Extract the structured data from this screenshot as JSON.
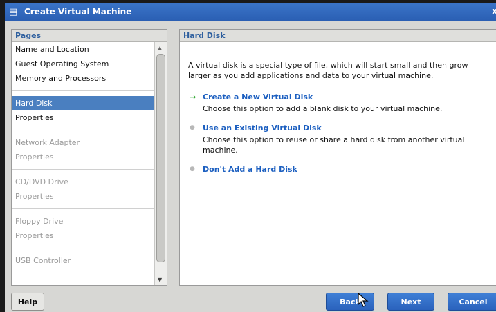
{
  "window": {
    "title": "Create Virtual Machine",
    "close_glyph": "x"
  },
  "pages_panel": {
    "header": "Pages",
    "groups": [
      {
        "items": [
          {
            "label": "Name and Location",
            "state": "normal"
          },
          {
            "label": "Guest Operating System",
            "state": "normal"
          },
          {
            "label": "Memory and Processors",
            "state": "normal"
          }
        ]
      },
      {
        "items": [
          {
            "label": "Hard Disk",
            "state": "selected"
          },
          {
            "label": "Properties",
            "state": "normal"
          }
        ]
      },
      {
        "items": [
          {
            "label": "Network Adapter",
            "state": "disabled"
          },
          {
            "label": "Properties",
            "state": "disabled"
          }
        ]
      },
      {
        "items": [
          {
            "label": "CD/DVD Drive",
            "state": "disabled"
          },
          {
            "label": "Properties",
            "state": "disabled"
          }
        ]
      },
      {
        "items": [
          {
            "label": "Floppy Drive",
            "state": "disabled"
          },
          {
            "label": "Properties",
            "state": "disabled"
          }
        ]
      },
      {
        "items": [
          {
            "label": "USB Controller",
            "state": "disabled"
          }
        ]
      }
    ]
  },
  "content_panel": {
    "header": "Hard Disk",
    "description": "A virtual disk is a special type of file, which will start small and then grow larger as you add applications and data to your virtual machine.",
    "options": [
      {
        "label": "Create a New Virtual Disk",
        "description": "Choose this option to add a blank disk to your virtual machine.",
        "active": true
      },
      {
        "label": "Use an Existing Virtual Disk",
        "description": "Choose this option to reuse or share a hard disk from another virtual machine.",
        "active": false
      },
      {
        "label": "Don't Add a Hard Disk",
        "description": "",
        "active": false
      }
    ]
  },
  "buttons": {
    "help": "Help",
    "back": "Back",
    "next": "Next",
    "cancel": "Cancel"
  },
  "colors": {
    "title_bar": "#2f66bb",
    "selection": "#4a7fc0",
    "link": "#1c5fc0",
    "active_arrow": "#29a329",
    "button_blue": "#2a62bc"
  },
  "icons": {
    "window": "vm-window-icon",
    "active_option": "right-arrow-icon",
    "inactive_option": "bullet-dot-icon"
  }
}
